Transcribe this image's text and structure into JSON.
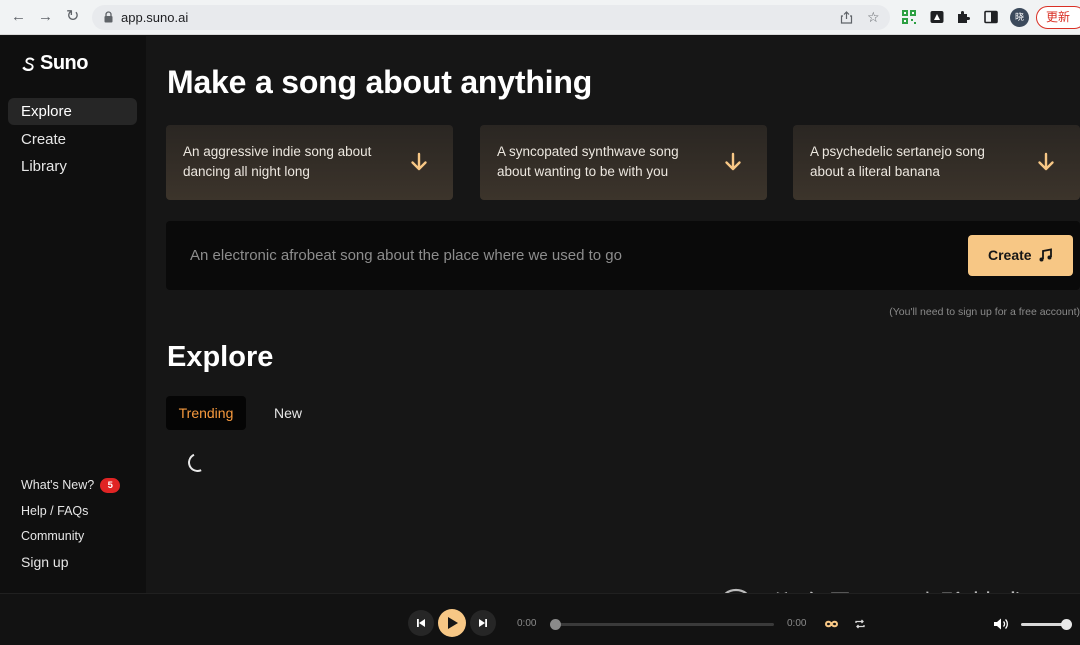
{
  "browser": {
    "url": "app.suno.ai",
    "update_label": "更新",
    "avatar_text": "晓"
  },
  "sidebar": {
    "logo": "Suno",
    "nav": [
      {
        "label": "Explore",
        "active": true
      },
      {
        "label": "Create",
        "active": false
      },
      {
        "label": "Library",
        "active": false
      }
    ],
    "footer": {
      "whats_new": "What's New?",
      "whats_new_count": "5",
      "help": "Help / FAQs",
      "community": "Community",
      "sign_up": "Sign up"
    }
  },
  "main": {
    "title": "Make a song about anything",
    "suggestions": [
      {
        "text": "An aggressive indie song about dancing all night long"
      },
      {
        "text": "A syncopated synthwave song about wanting to be with you"
      },
      {
        "text": "A psychedelic sertanejo song about a literal banana"
      }
    ],
    "prompt_placeholder": "An electronic afrobeat song about the place where we used to go",
    "create_label": "Create",
    "signup_note": "(You'll need to sign up for a free account)",
    "explore_title": "Explore",
    "tabs": [
      {
        "label": "Trending",
        "active": true
      },
      {
        "label": "New",
        "active": false
      }
    ]
  },
  "player": {
    "current_time": "0:00",
    "duration": "0:00",
    "progress": 0,
    "volume": 0.9
  },
  "watermark": "公众号 · 子晓聊技术",
  "colors": {
    "accent": "#f7c785",
    "active_tab": "#f79a3e",
    "badge": "#e02424"
  }
}
